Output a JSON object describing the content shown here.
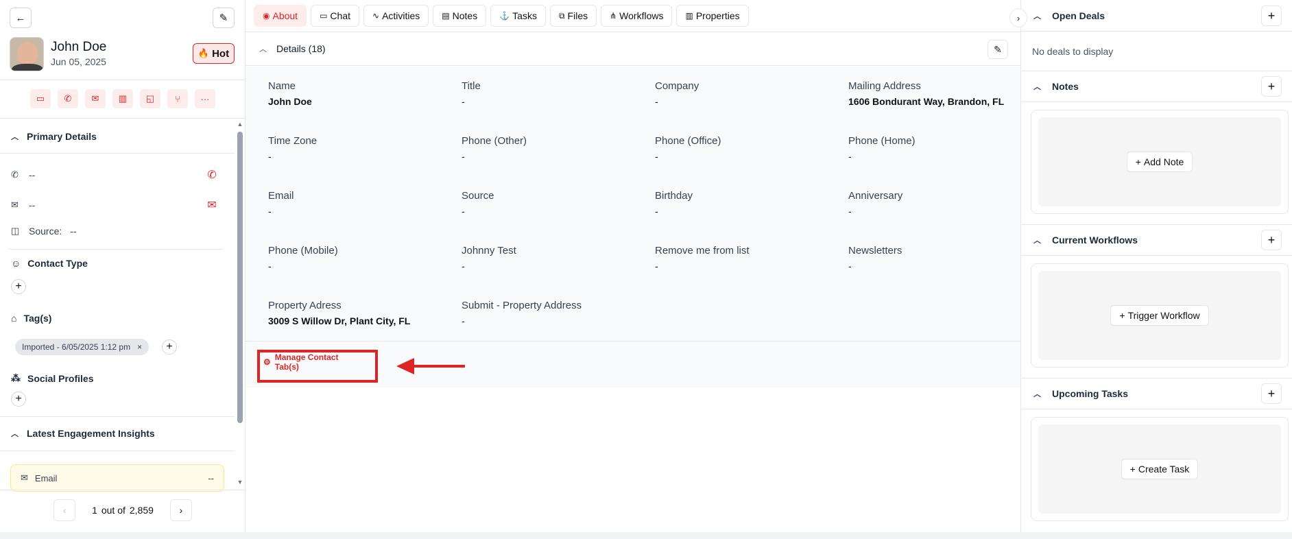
{
  "contact": {
    "name": "John Doe",
    "date": "Jun 05, 2025",
    "status_label": "Hot"
  },
  "left": {
    "primary_details_title": "Primary Details",
    "phone_value": "--",
    "email_value": "--",
    "source_label": "Source:",
    "source_value": "--",
    "contact_type_title": "Contact Type",
    "tags_title": "Tag(s)",
    "tag_chip": "Imported - 6/05/2025 1:12 pm",
    "tag_remove": "×",
    "social_profiles_title": "Social Profiles",
    "engagement_title": "Latest Engagement Insights",
    "engagement_email_label": "Email",
    "engagement_email_value": "--",
    "pager_current": "1",
    "pager_out_of": "out of",
    "pager_total": "2,859"
  },
  "tabs": [
    {
      "label": "About",
      "icon": "user-circle-icon"
    },
    {
      "label": "Chat",
      "icon": "chat-icon"
    },
    {
      "label": "Activities",
      "icon": "activity-icon"
    },
    {
      "label": "Notes",
      "icon": "notes-icon"
    },
    {
      "label": "Tasks",
      "icon": "anchor-icon"
    },
    {
      "label": "Files",
      "icon": "files-icon"
    },
    {
      "label": "Workflows",
      "icon": "workflow-icon"
    },
    {
      "label": "Properties",
      "icon": "building-icon"
    }
  ],
  "details": {
    "title": "Details (18)",
    "fields": [
      {
        "label": "Name",
        "value": "John Doe"
      },
      {
        "label": "Title",
        "value": "-"
      },
      {
        "label": "Company",
        "value": "-"
      },
      {
        "label": "Mailing Address",
        "value": "1606 Bondurant Way, Brandon, FL"
      },
      {
        "label": "Time Zone",
        "value": "-"
      },
      {
        "label": "Phone (Other)",
        "value": "-"
      },
      {
        "label": "Phone (Office)",
        "value": "-"
      },
      {
        "label": "Phone (Home)",
        "value": "-"
      },
      {
        "label": "Email",
        "value": "-"
      },
      {
        "label": "Source",
        "value": "-"
      },
      {
        "label": "Birthday",
        "value": "-"
      },
      {
        "label": "Anniversary",
        "value": "-"
      },
      {
        "label": "Phone (Mobile)",
        "value": "-"
      },
      {
        "label": "Johnny Test",
        "value": "-"
      },
      {
        "label": "Remove me from list",
        "value": "-"
      },
      {
        "label": "Newsletters",
        "value": "-"
      },
      {
        "label": "Property Adress",
        "value": "3009 S Willow Dr, Plant City, FL"
      },
      {
        "label": "Submit - Property Address",
        "value": "-"
      }
    ],
    "manage_label": "Manage Contact Tab(s)"
  },
  "right": {
    "open_deals_title": "Open Deals",
    "no_deals_text": "No deals to display",
    "notes_title": "Notes",
    "add_note_label": "Add Note",
    "workflows_title": "Current Workflows",
    "trigger_workflow_label": "Trigger Workflow",
    "tasks_title": "Upcoming Tasks",
    "create_task_label": "Create Task"
  },
  "colors": {
    "accent": "#dc2626",
    "accent_bg": "#fdecec",
    "annotation": "#dc2626"
  }
}
